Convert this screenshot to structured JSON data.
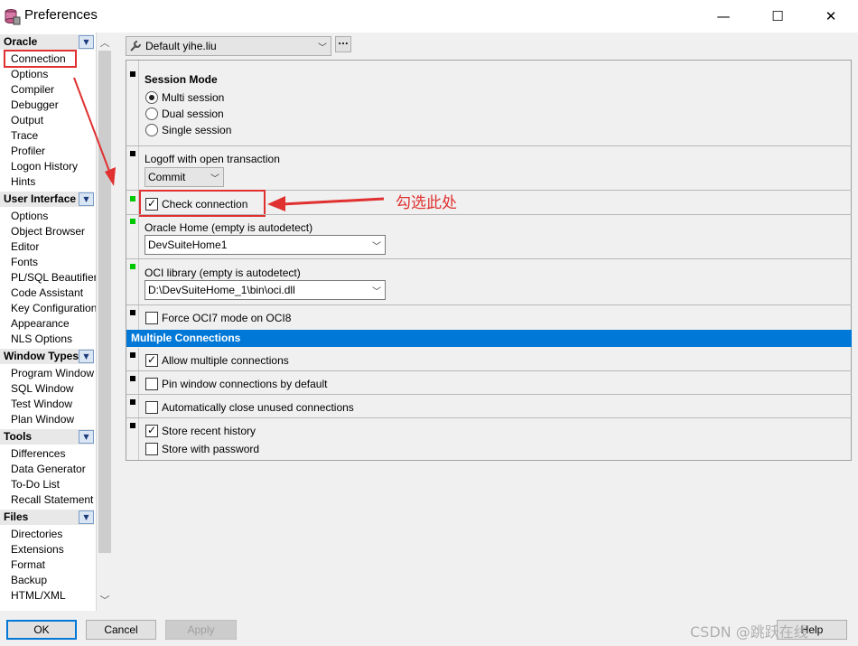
{
  "window": {
    "title": "Preferences",
    "minimize": "—",
    "maximize": "☐",
    "close": "✕"
  },
  "nav": {
    "categories": [
      {
        "label": "Oracle",
        "items": [
          "Connection",
          "Options",
          "Compiler",
          "Debugger",
          "Output",
          "Trace",
          "Profiler",
          "Logon History",
          "Hints"
        ]
      },
      {
        "label": "User Interface",
        "items": [
          "Options",
          "Object Browser",
          "Editor",
          "Fonts",
          "PL/SQL Beautifier",
          "Code Assistant",
          "Key Configuration",
          "Appearance",
          "NLS Options"
        ]
      },
      {
        "label": "Window Types",
        "items": [
          "Program Window",
          "SQL Window",
          "Test Window",
          "Plan Window"
        ]
      },
      {
        "label": "Tools",
        "items": [
          "Differences",
          "Data Generator",
          "To-Do List",
          "Recall Statement"
        ]
      },
      {
        "label": "Files",
        "items": [
          "Directories",
          "Extensions",
          "Format",
          "Backup",
          "HTML/XML"
        ]
      }
    ],
    "selected": "Connection"
  },
  "profile": {
    "value": "Default yihe.liu",
    "more_button": "..."
  },
  "session_mode": {
    "heading": "Session Mode",
    "options": [
      "Multi session",
      "Dual session",
      "Single session"
    ],
    "selected": "Multi session"
  },
  "logoff": {
    "label": "Logoff with open transaction",
    "value": "Commit"
  },
  "check_connection": {
    "label": "Check connection",
    "checked": true
  },
  "oracle_home": {
    "label": "Oracle Home (empty is autodetect)",
    "value": "DevSuiteHome1"
  },
  "oci_library": {
    "label": "OCI library (empty is autodetect)",
    "value": "D:\\DevSuiteHome_1\\bin\\oci.dll"
  },
  "force_oci7": {
    "label": "Force OCI7 mode on OCI8",
    "checked": false
  },
  "multiple_connections": {
    "heading": "Multiple Connections",
    "allow": {
      "label": "Allow multiple connections",
      "checked": true
    },
    "pin": {
      "label": "Pin window connections by default",
      "checked": false
    },
    "auto_close": {
      "label": "Automatically close unused connections",
      "checked": false
    },
    "store_history": {
      "label": "Store recent history",
      "checked": true
    },
    "store_password": {
      "label": "Store with password",
      "checked": false
    }
  },
  "annotation": {
    "text": "勾选此处",
    "color": "#e03030"
  },
  "buttons": {
    "ok": "OK",
    "cancel": "Cancel",
    "apply": "Apply",
    "help": "Help"
  },
  "watermark": "CSDN @跳跃在线",
  "colors": {
    "accent": "#0078d7",
    "annotation": "#e03030",
    "marker_active": "#00c800"
  }
}
